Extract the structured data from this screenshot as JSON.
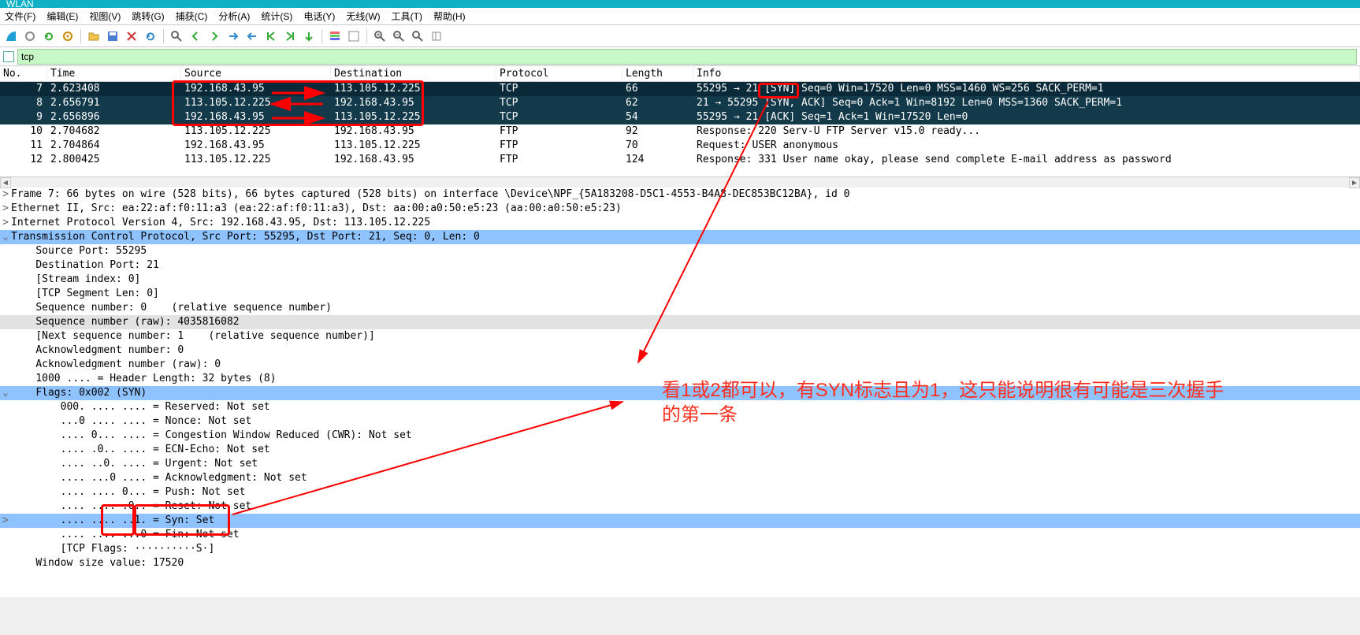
{
  "window": {
    "title": "WLAN"
  },
  "menu": {
    "items": [
      {
        "label": "文件(F)"
      },
      {
        "label": "编辑(E)"
      },
      {
        "label": "视图(V)"
      },
      {
        "label": "跳转(G)"
      },
      {
        "label": "捕获(C)"
      },
      {
        "label": "分析(A)"
      },
      {
        "label": "统计(S)"
      },
      {
        "label": "电话(Y)"
      },
      {
        "label": "无线(W)"
      },
      {
        "label": "工具(T)"
      },
      {
        "label": "帮助(H)"
      }
    ]
  },
  "filter": {
    "value": "tcp"
  },
  "columns": {
    "no": "No.",
    "time": "Time",
    "src": "Source",
    "dst": "Destination",
    "proto": "Protocol",
    "len": "Length",
    "info": "Info"
  },
  "packets": [
    {
      "no": "7",
      "time": "2.623408",
      "src": "192.168.43.95",
      "dst": "113.105.12.225",
      "proto": "TCP",
      "len": "66",
      "info": "55295 → 21 [SYN] Seq=0 Win=17520 Len=0 MSS=1460 WS=256 SACK_PERM=1",
      "cls": "sel-dark"
    },
    {
      "no": "8",
      "time": "2.656791",
      "src": "113.105.12.225",
      "dst": "192.168.43.95",
      "proto": "TCP",
      "len": "62",
      "info": "21 → 55295 [SYN, ACK] Seq=0 Ack=1 Win=8192 Len=0 MSS=1360 SACK_PERM=1",
      "cls": "sel-dark2"
    },
    {
      "no": "9",
      "time": "2.656896",
      "src": "192.168.43.95",
      "dst": "113.105.12.225",
      "proto": "TCP",
      "len": "54",
      "info": "55295 → 21 [ACK] Seq=1 Ack=1 Win=17520 Len=0",
      "cls": "sel-dark2"
    },
    {
      "no": "10",
      "time": "2.704682",
      "src": "113.105.12.225",
      "dst": "192.168.43.95",
      "proto": "FTP",
      "len": "92",
      "info": "Response: 220 Serv-U FTP Server v15.0 ready...",
      "cls": "light"
    },
    {
      "no": "11",
      "time": "2.704864",
      "src": "192.168.43.95",
      "dst": "113.105.12.225",
      "proto": "FTP",
      "len": "70",
      "info": "Request: USER anonymous",
      "cls": "light"
    },
    {
      "no": "12",
      "time": "2.800425",
      "src": "113.105.12.225",
      "dst": "192.168.43.95",
      "proto": "FTP",
      "len": "124",
      "info": "Response: 331 User name okay, please send complete E-mail address as password",
      "cls": "light"
    }
  ],
  "details": [
    {
      "indent": 0,
      "tw": ">",
      "text": "Frame 7: 66 bytes on wire (528 bits), 66 bytes captured (528 bits) on interface \\Device\\NPF_{5A183208-D5C1-4553-B4A8-DEC853BC12BA}, id 0",
      "hl": ""
    },
    {
      "indent": 0,
      "tw": ">",
      "text": "Ethernet II, Src: ea:22:af:f0:11:a3 (ea:22:af:f0:11:a3), Dst: aa:00:a0:50:e5:23 (aa:00:a0:50:e5:23)",
      "hl": ""
    },
    {
      "indent": 0,
      "tw": ">",
      "text": "Internet Protocol Version 4, Src: 192.168.43.95, Dst: 113.105.12.225",
      "hl": ""
    },
    {
      "indent": 0,
      "tw": "v",
      "text": "Transmission Control Protocol, Src Port: 55295, Dst Port: 21, Seq: 0, Len: 0",
      "hl": "hl-blue"
    },
    {
      "indent": 1,
      "tw": "",
      "text": "Source Port: 55295",
      "hl": ""
    },
    {
      "indent": 1,
      "tw": "",
      "text": "Destination Port: 21",
      "hl": ""
    },
    {
      "indent": 1,
      "tw": "",
      "text": "[Stream index: 0]",
      "hl": ""
    },
    {
      "indent": 1,
      "tw": "",
      "text": "[TCP Segment Len: 0]",
      "hl": ""
    },
    {
      "indent": 1,
      "tw": "",
      "text": "Sequence number: 0    (relative sequence number)",
      "hl": ""
    },
    {
      "indent": 1,
      "tw": "",
      "text": "Sequence number (raw): 4035816082",
      "hl": "hl-grey"
    },
    {
      "indent": 1,
      "tw": "",
      "text": "[Next sequence number: 1    (relative sequence number)]",
      "hl": ""
    },
    {
      "indent": 1,
      "tw": "",
      "text": "Acknowledgment number: 0",
      "hl": ""
    },
    {
      "indent": 1,
      "tw": "",
      "text": "Acknowledgment number (raw): 0",
      "hl": ""
    },
    {
      "indent": 1,
      "tw": "",
      "text": "1000 .... = Header Length: 32 bytes (8)",
      "hl": ""
    },
    {
      "indent": 1,
      "tw": "v",
      "text": "Flags: 0x002 (SYN)",
      "hl": "hl-blue"
    },
    {
      "indent": 2,
      "tw": "",
      "text": "000. .... .... = Reserved: Not set",
      "hl": ""
    },
    {
      "indent": 2,
      "tw": "",
      "text": "...0 .... .... = Nonce: Not set",
      "hl": ""
    },
    {
      "indent": 2,
      "tw": "",
      "text": ".... 0... .... = Congestion Window Reduced (CWR): Not set",
      "hl": ""
    },
    {
      "indent": 2,
      "tw": "",
      "text": ".... .0.. .... = ECN-Echo: Not set",
      "hl": ""
    },
    {
      "indent": 2,
      "tw": "",
      "text": ".... ..0. .... = Urgent: Not set",
      "hl": ""
    },
    {
      "indent": 2,
      "tw": "",
      "text": ".... ...0 .... = Acknowledgment: Not set",
      "hl": ""
    },
    {
      "indent": 2,
      "tw": "",
      "text": ".... .... 0... = Push: Not set",
      "hl": ""
    },
    {
      "indent": 2,
      "tw": "",
      "text": ".... .... .0.. = Reset: Not set",
      "hl": ""
    },
    {
      "indent": 2,
      "tw": ">",
      "text": ".... .... ..1. = Syn: Set",
      "hl": "hl-blue"
    },
    {
      "indent": 2,
      "tw": "",
      "text": ".... .... ...0 = Fin: Not set",
      "hl": ""
    },
    {
      "indent": 2,
      "tw": "",
      "text": "[TCP Flags: ··········S·]",
      "hl": ""
    },
    {
      "indent": 1,
      "tw": "",
      "text": "Window size value: 17520",
      "hl": ""
    }
  ],
  "annotation": {
    "text": "看1或2都可以，有SYN标志且为1，这只能说明很有可能是三次握手的第一条"
  }
}
